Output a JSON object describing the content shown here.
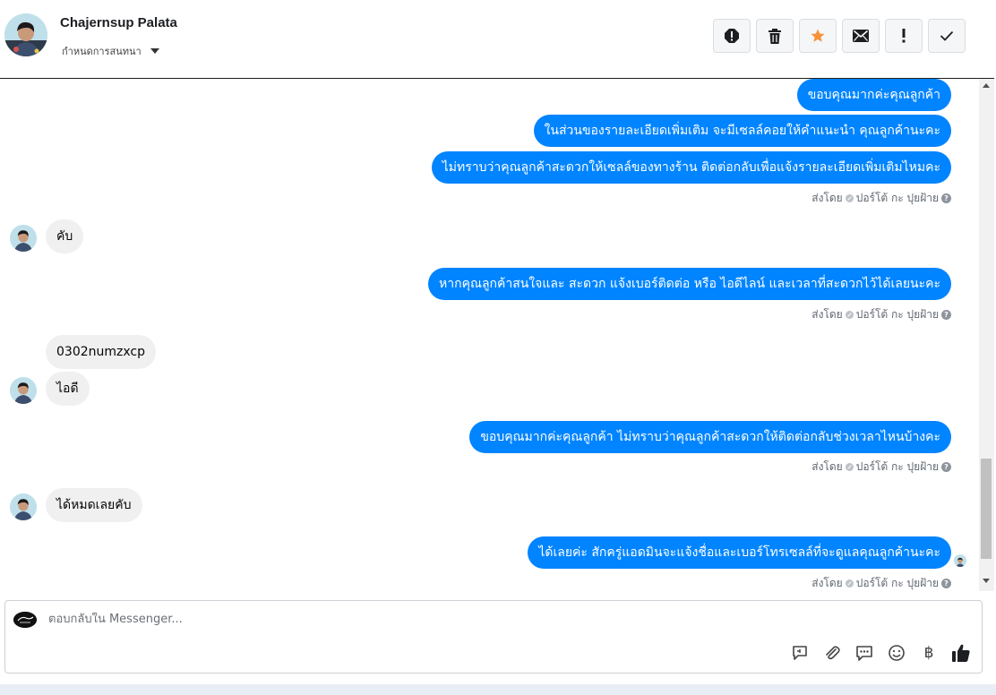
{
  "header": {
    "contact_name": "Chajernsup Palata",
    "subtitle": "กำหนดการสนทนา",
    "toolbar": [
      {
        "name": "spam-report-icon"
      },
      {
        "name": "trash-icon"
      },
      {
        "name": "star-icon",
        "color": "#f7923a"
      },
      {
        "name": "mark-unread-icon"
      },
      {
        "name": "important-icon"
      },
      {
        "name": "done-check-icon"
      }
    ]
  },
  "messages": [
    {
      "dir": "out",
      "text": "ขอบคุณมากค่ะคุณลูกค้า"
    },
    {
      "dir": "out",
      "text": "ในส่วนของรายละเอียดเพิ่มเติม จะมีเซลล์คอยให้คำแนะนำ คุณลูกค้านะคะ"
    },
    {
      "dir": "out",
      "text": "ไม่ทราบว่าคุณลูกค้าสะดวกให้เซลล์ของทางร้าน ติดต่อกลับเพื่อแจ้งรายละเอียดเพิ่มเติมไหมคะ"
    },
    {
      "dir": "meta",
      "text": "ส่งโดย",
      "agent": "ปอร์โต้ กะ ปุยฝ้าย"
    },
    {
      "dir": "in",
      "text": "คับ"
    },
    {
      "dir": "out",
      "text": "หากคุณลูกค้าสนใจและ สะดวก แจ้งเบอร์ติดต่อ หรือ ไอดีไลน์ และเวลาที่สะดวกไว้ได้เลยนะคะ"
    },
    {
      "dir": "meta",
      "text": "ส่งโดย",
      "agent": "ปอร์โต้ กะ ปุยฝ้าย"
    },
    {
      "dir": "in",
      "text": "0302numzxcp"
    },
    {
      "dir": "in",
      "text": "ไอดี"
    },
    {
      "dir": "out",
      "text": "ขอบคุณมากค่ะคุณลูกค้า ไม่ทราบว่าคุณลูกค้าสะดวกให้ติดต่อกลับช่วงเวลาไหนบ้างคะ"
    },
    {
      "dir": "meta",
      "text": "ส่งโดย",
      "agent": "ปอร์โต้ กะ ปุยฝ้าย"
    },
    {
      "dir": "in",
      "text": "ได้หมดเลยคับ"
    },
    {
      "dir": "out",
      "text": "ได้เลยค่ะ สักครู่แอดมินจะแจ้งชื่อและเบอร์โทรเซลล์ที่จะดูแลคุณลูกค้านะคะ"
    },
    {
      "dir": "meta",
      "text": "ส่งโดย",
      "agent": "ปอร์โต้ กะ ปุยฝ้าย"
    }
  ],
  "composer": {
    "placeholder": "ตอบกลับใน Messenger...",
    "tools": [
      "saved-reply-icon",
      "attachment-icon",
      "quick-reply-icon",
      "emoji-icon",
      "baht-payment-icon",
      "thumbs-up-icon"
    ],
    "currency_symbol": "฿"
  },
  "colors": {
    "outgoing_bubble": "#0084ff",
    "incoming_bubble": "#f0f0f0"
  }
}
